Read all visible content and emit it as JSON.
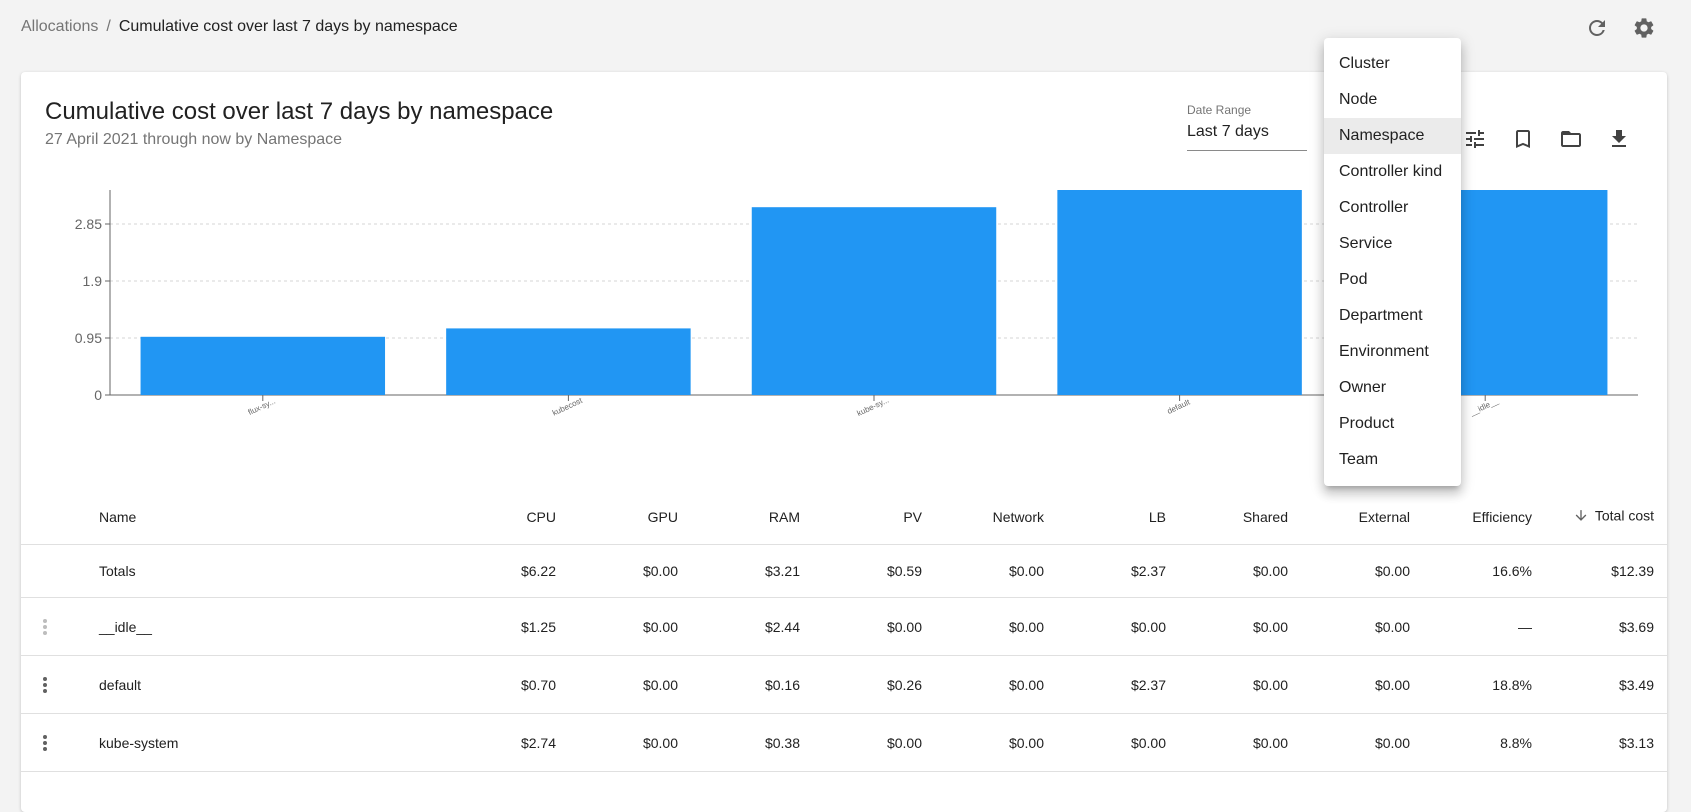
{
  "breadcrumb": {
    "root": "Allocations",
    "separator": "/",
    "current": "Cumulative cost over last 7 days by namespace"
  },
  "header_icons": [
    "refresh-icon",
    "settings-icon"
  ],
  "report": {
    "title": "Cumulative cost over last 7 days by namespace",
    "subtitle": "27 April 2021 through now by Namespace",
    "date_range_label": "Date Range",
    "date_range_value": "Last 7 days",
    "actions": [
      "tune-icon",
      "bookmark-icon",
      "folder-icon",
      "download-icon"
    ]
  },
  "accent_color": "#2196f3",
  "chart_data": {
    "type": "bar",
    "categories": [
      "flux-sy...",
      "kubecost",
      "kube-sy...",
      "default",
      "__idle__"
    ],
    "values": [
      0.97,
      1.11,
      3.13,
      3.49,
      3.69
    ],
    "yticks": [
      "0",
      "0.95",
      "1.9",
      "2.85",
      "3.8"
    ],
    "ylim": [
      0,
      3.8
    ],
    "grid": true,
    "color": "#2196f3"
  },
  "table": {
    "columns": [
      "Name",
      "CPU",
      "GPU",
      "RAM",
      "PV",
      "Network",
      "LB",
      "Shared",
      "External",
      "Efficiency",
      "Total cost"
    ],
    "sort_column": "Total cost",
    "sort_direction": "descending",
    "totals": [
      "Totals",
      "$6.22",
      "$0.00",
      "$3.21",
      "$0.59",
      "$0.00",
      "$2.37",
      "$0.00",
      "$0.00",
      "16.6%",
      "$12.39"
    ],
    "rows": [
      [
        "__idle__",
        "$1.25",
        "$0.00",
        "$2.44",
        "$0.00",
        "$0.00",
        "$0.00",
        "$0.00",
        "$0.00",
        "—",
        "$3.69"
      ],
      [
        "default",
        "$0.70",
        "$0.00",
        "$0.16",
        "$0.26",
        "$0.00",
        "$2.37",
        "$0.00",
        "$0.00",
        "18.8%",
        "$3.49"
      ],
      [
        "kube-system",
        "$2.74",
        "$0.00",
        "$0.38",
        "$0.00",
        "$0.00",
        "$0.00",
        "$0.00",
        "$0.00",
        "8.8%",
        "$3.13"
      ]
    ]
  },
  "aggregate_menu": {
    "items": [
      "Cluster",
      "Node",
      "Namespace",
      "Controller kind",
      "Controller",
      "Service",
      "Pod",
      "Department",
      "Environment",
      "Owner",
      "Product",
      "Team"
    ],
    "selected": "Namespace"
  }
}
